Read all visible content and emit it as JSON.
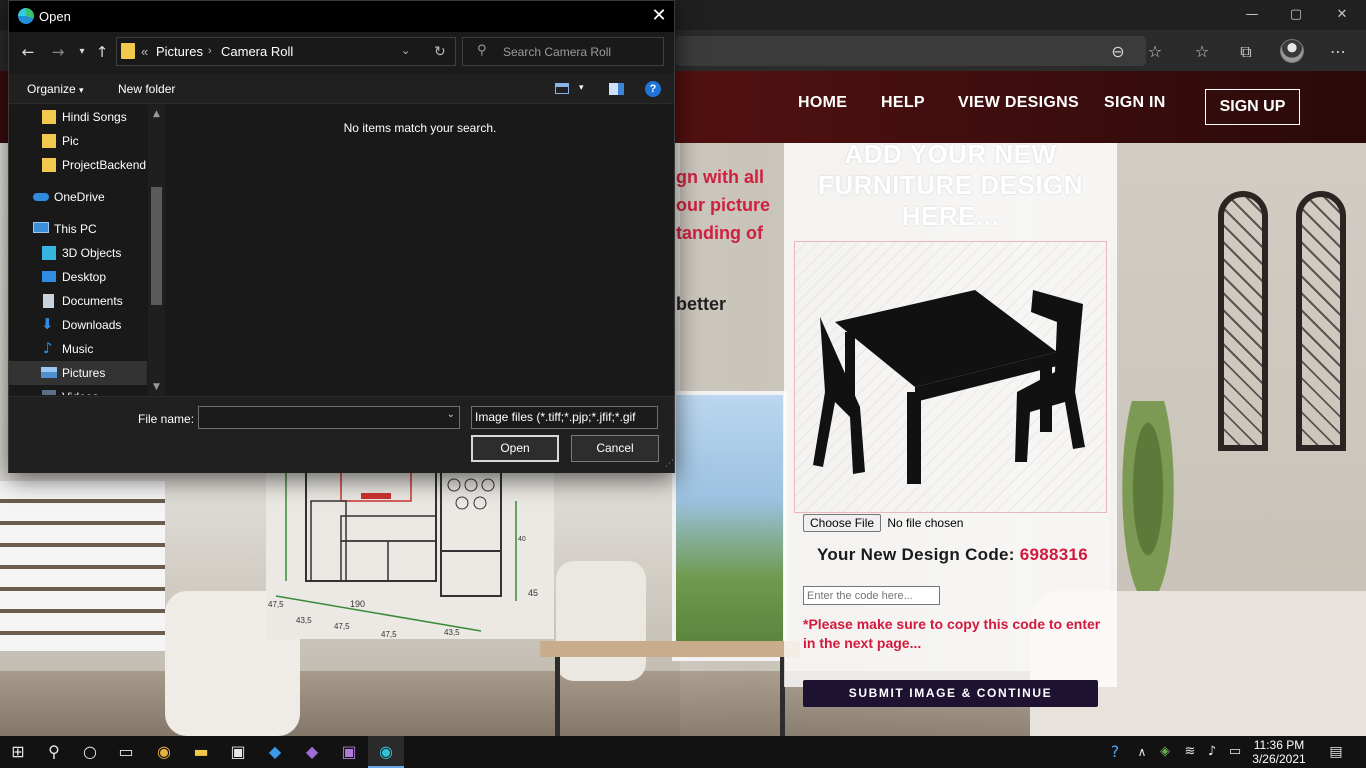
{
  "browser": {
    "window_controls": [
      "—",
      "▢",
      "✕"
    ],
    "toolbar_icons": [
      "zoom-out-icon",
      "favorite-add-icon",
      "favorites-icon",
      "collections-icon",
      "profile-icon",
      "more-icon"
    ]
  },
  "site": {
    "nav": [
      "HOME",
      "HELP",
      "VIEW DESIGNS",
      "SIGN IN"
    ],
    "signup_label": "SIGN UP",
    "intro_lines": [
      "gn with all",
      "our picture",
      "tanding of"
    ],
    "intro_dark": "better",
    "drawing_dims": [
      "47,5",
      "43,5",
      "47,5",
      "47,5",
      "43,5",
      "190",
      "45",
      "40"
    ],
    "panel": {
      "title": "ADD YOUR NEW FURNITURE DESIGN HERE...",
      "choose_file": "Choose File",
      "no_file": "No file chosen",
      "code_label": "Your New Design Code:",
      "code_value": "6988316",
      "code_placeholder": "Enter the code here...",
      "note": "*Please make sure to copy this code to enter in the next page...",
      "submit": "SUBMIT IMAGE & CONTINUE"
    }
  },
  "dialog": {
    "title": "Open",
    "path": [
      "Pictures",
      "Camera Roll"
    ],
    "path_overflow": "«",
    "search_placeholder": "Search Camera Roll",
    "organize": "Organize",
    "new_folder": "New folder",
    "nav_items": [
      {
        "label": "Hindi Songs",
        "icon": "folder-icon"
      },
      {
        "label": "Pic",
        "icon": "folder-icon"
      },
      {
        "label": "ProjectBackend",
        "icon": "folder-icon"
      },
      {
        "label": "OneDrive",
        "icon": "cloud-icon"
      },
      {
        "label": "This PC",
        "icon": "computer-icon"
      },
      {
        "label": "3D Objects",
        "icon": "cube-icon"
      },
      {
        "label": "Desktop",
        "icon": "desktop-icon"
      },
      {
        "label": "Documents",
        "icon": "document-icon"
      },
      {
        "label": "Downloads",
        "icon": "download-icon"
      },
      {
        "label": "Music",
        "icon": "music-icon"
      },
      {
        "label": "Pictures",
        "icon": "pictures-icon"
      },
      {
        "label": "Videos",
        "icon": "video-icon"
      }
    ],
    "empty_message": "No items match your search.",
    "file_name_label": "File name:",
    "file_name_value": "",
    "file_type": "Image files (*.tiff;*.pjp;*.jfif;*.gif",
    "open_button": "Open",
    "cancel_button": "Cancel"
  },
  "taskbar": {
    "time": "11:36 PM",
    "date": "3/26/2021"
  },
  "colors": {
    "accent_red": "#d21a3c",
    "submit_bg": "#1e1233",
    "header_bg": "#4a1010",
    "dialog_bg": "#1b1b1b"
  }
}
